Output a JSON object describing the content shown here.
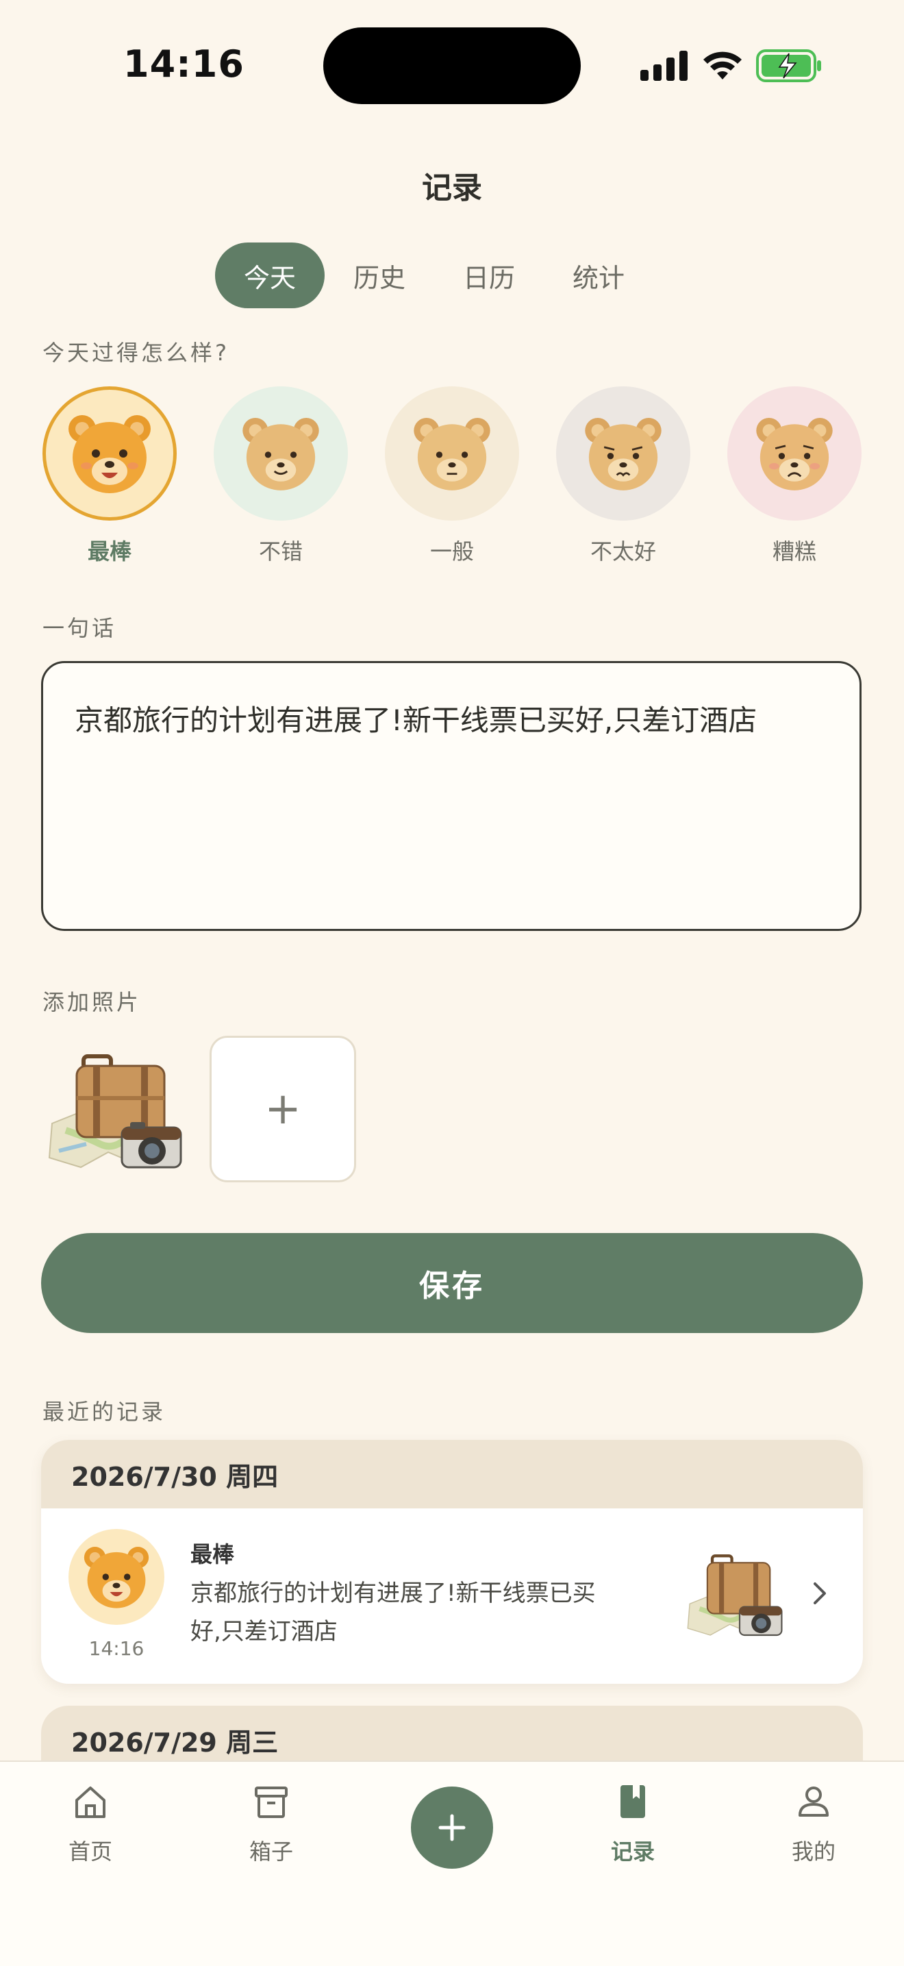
{
  "status": {
    "time": "14:16"
  },
  "header": {
    "title": "记录"
  },
  "tabs": [
    {
      "label": "今天",
      "active": true
    },
    {
      "label": "历史",
      "active": false
    },
    {
      "label": "日历",
      "active": false
    },
    {
      "label": "统计",
      "active": false
    }
  ],
  "mood_section": {
    "label": "今天过得怎么样?",
    "options": [
      {
        "label": "最棒",
        "selected": true
      },
      {
        "label": "不错",
        "selected": false
      },
      {
        "label": "一般",
        "selected": false
      },
      {
        "label": "不太好",
        "selected": false
      },
      {
        "label": "糟糕",
        "selected": false
      }
    ]
  },
  "note_section": {
    "label": "一句话",
    "value": "京都旅行的计划有进展了!新干线票已买好,只差订酒店"
  },
  "photo_section": {
    "label": "添加照片",
    "add_symbol": "+"
  },
  "save_button": {
    "label": "保存"
  },
  "recent": {
    "label": "最近的记录",
    "entries": [
      {
        "date": "2026/7/30 周四",
        "mood": "最棒",
        "time": "14:16",
        "text_line1": "京都旅行的计划有进展了!新干线票已买",
        "text_line2": "好,只差订酒店"
      },
      {
        "date": "2026/7/29 周三"
      }
    ]
  },
  "tabbar": {
    "items": [
      {
        "label": "首页",
        "icon": "home-icon"
      },
      {
        "label": "箱子",
        "icon": "box-icon"
      },
      {
        "label": "",
        "icon": "plus-icon"
      },
      {
        "label": "记录",
        "icon": "bookmark-book-icon",
        "active": true
      },
      {
        "label": "我的",
        "icon": "person-icon"
      }
    ]
  },
  "colors": {
    "accent": "#607D66",
    "background": "#FCF6EC",
    "card_header": "#EEE4D3"
  }
}
